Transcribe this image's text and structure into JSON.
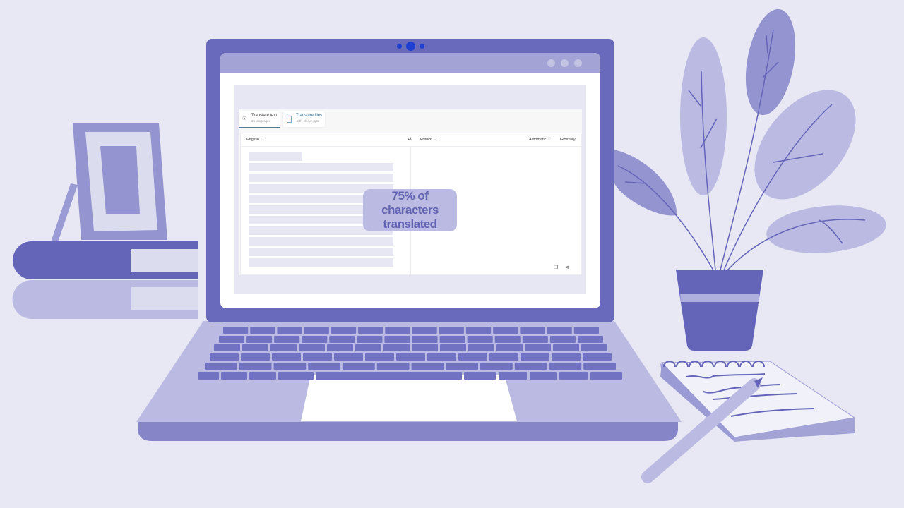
{
  "scene": {
    "description": "Illustration of a laptop showing a translation app",
    "colors": {
      "background": "#e8e8f4",
      "primary": "#6a6abc",
      "medium": "#9494d0",
      "light": "#babae2",
      "pale": "#dcdcef",
      "camera": "#1f3fd1",
      "badge_text": "#6464b5"
    }
  },
  "browser": {
    "window_controls": [
      "dot",
      "dot",
      "dot"
    ]
  },
  "app": {
    "tabs": [
      {
        "label": "Translate text",
        "sub": "26 languages",
        "icon": "globe-icon",
        "active": true
      },
      {
        "label": "Translate files",
        "sub": ".pdf, .docx, .pptx",
        "icon": "document-icon",
        "active": false
      }
    ],
    "source_language": "English",
    "target_language": "French",
    "swap_icon": "swap-arrows-icon",
    "formality": "Automatic",
    "glossary_label": "Glossary",
    "copy_icon": "copy-icon",
    "share_icon": "share-icon"
  },
  "overlay": {
    "line1": "75% of characters",
    "line2": "translated",
    "progress_percent": 75
  }
}
